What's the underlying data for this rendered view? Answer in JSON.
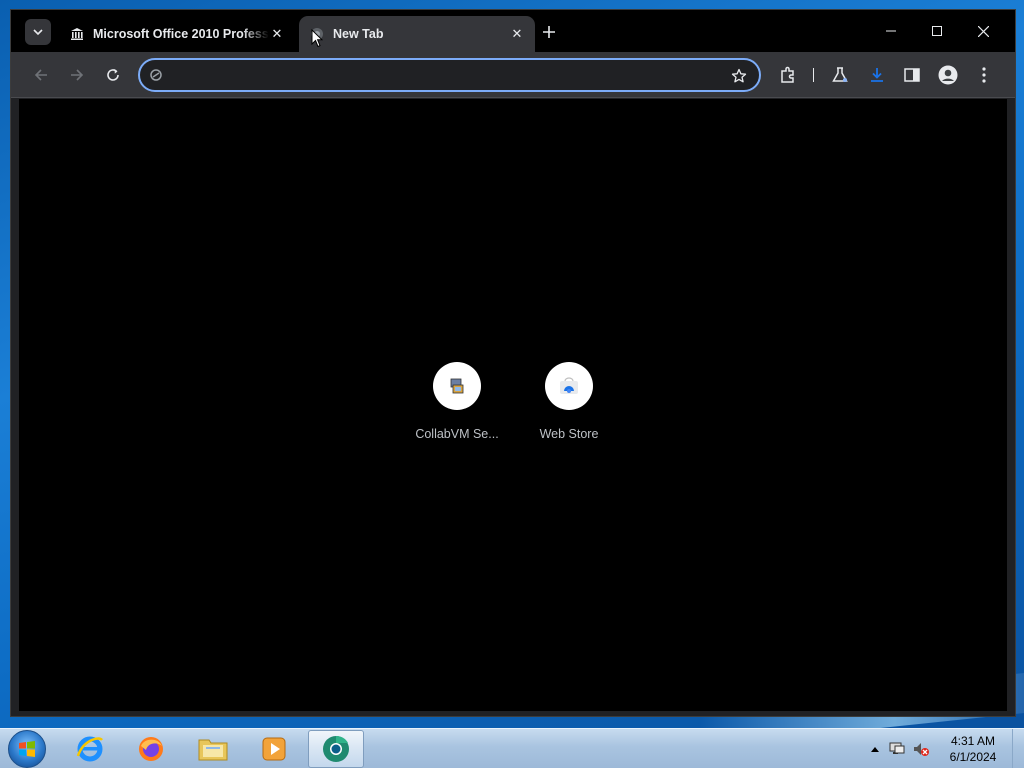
{
  "browser": {
    "tabs": [
      {
        "title": "Microsoft Office 2010 Professi",
        "favicon": "museum-icon",
        "active": false
      },
      {
        "title": "New Tab",
        "favicon": "globe-icon",
        "active": true
      }
    ],
    "omnibox": {
      "value": "",
      "placeholder": ""
    },
    "shortcuts": [
      {
        "label": "CollabVM Se...",
        "icon": "collabvm-icon"
      },
      {
        "label": "Web Store",
        "icon": "web-store-icon"
      }
    ],
    "theme": {
      "frame": "#000000",
      "toolbar": "#35363a",
      "focus_ring": "#7cacf8",
      "accent": "#1a73e8"
    }
  },
  "taskbar": {
    "apps": [
      {
        "name": "Internet Explorer",
        "icon": "ie-icon"
      },
      {
        "name": "Firefox",
        "icon": "firefox-icon"
      },
      {
        "name": "Windows Explorer",
        "icon": "folder-icon"
      },
      {
        "name": "Windows Media Player",
        "icon": "media-player-icon"
      },
      {
        "name": "Chrome Beta",
        "icon": "chrome-icon",
        "active": true
      }
    ],
    "clock": {
      "time": "4:31 AM",
      "date": "6/1/2024"
    }
  }
}
